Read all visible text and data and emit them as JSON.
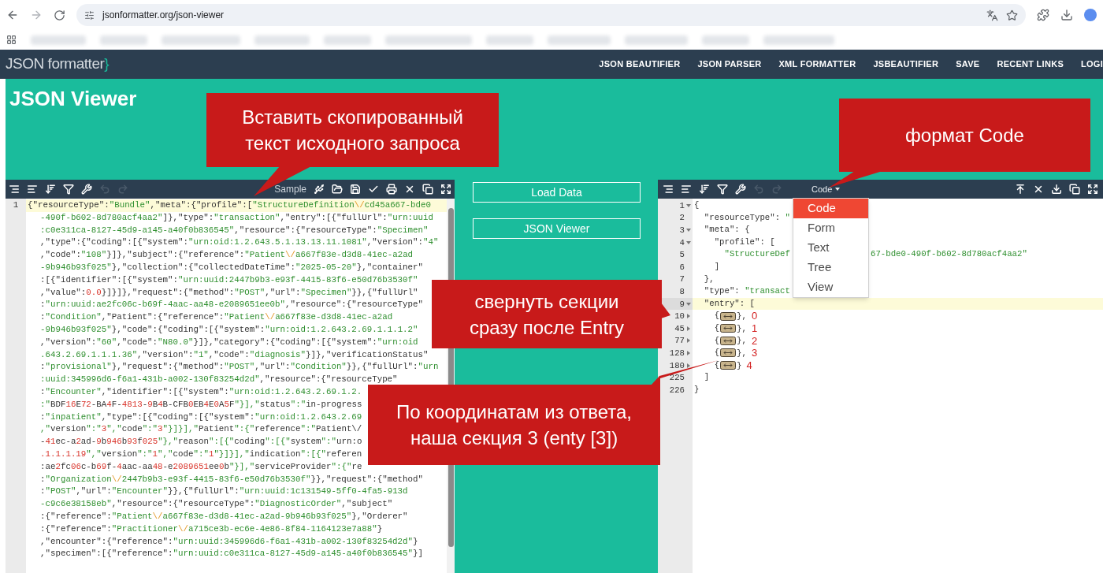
{
  "browser": {
    "url": "jsonformatter.org/json-viewer"
  },
  "site": {
    "logo": "JSON formatter",
    "logo_brace": "}",
    "nav": [
      "JSON BEAUTIFIER",
      "JSON PARSER",
      "XML FORMATTER",
      "JSBEAUTIFIER",
      "SAVE",
      "RECENT LINKS",
      "LOGI"
    ],
    "page_title": "JSON Viewer"
  },
  "input_editor": {
    "sample_label": "Sample",
    "line_number": "1",
    "lines": [
      {
        "text": "{\"resourceType\":\"Bundle\",\"meta\":{\"profile\":[\"StructureDefinition\\/cd45a667-bde0",
        "active": true
      },
      {
        "text": "-490f-b602-8d780acf4aa2\"]},\"type\":\"transaction\",\"entry\":[{\"fullUrl\":\"urn:uuid",
        "active": false
      },
      {
        "text": ":c0e311ca-8127-45d9-a145-a40f0b836545\",\"resource\":{\"resourceType\":\"Specimen\"",
        "active": false
      },
      {
        "text": ",\"type\":{\"coding\":[{\"system\":\"urn:oid:1.2.643.5.1.13.13.11.1081\",\"version\":\"4\"",
        "active": false
      },
      {
        "text": ",\"code\":\"108\"}]},\"subject\":{\"reference\":\"Patient\\/a667f83e-d3d8-41ec-a2ad",
        "active": false
      },
      {
        "text": "-9b946b93f025\"},\"collection\":{\"collectedDateTime\":\"2025-05-20\"},\"container\"",
        "active": false
      },
      {
        "text": ":[{\"identifier\":[{\"system\":\"urn:uuid:2447b9b3-e93f-4415-83f6-e50d76b3530f\"",
        "active": false
      },
      {
        "text": ",\"value\":0.0}]}]},\"request\":{\"method\":\"POST\",\"url\":\"Specimen\"}},{\"fullUrl\"",
        "active": false
      },
      {
        "text": ":\"urn:uuid:ae2fc06c-b69f-4aac-aa48-e2089651ee0b\",\"resource\":{\"resourceType\"",
        "active": false
      },
      {
        "text": ":\"Condition\",\"Patient\":{\"reference\":\"Patient\\/a667f83e-d3d8-41ec-a2ad",
        "active": false
      },
      {
        "text": "-9b946b93f025\"},\"code\":{\"coding\":[{\"system\":\"urn:oid:1.2.643.2.69.1.1.1.2\"",
        "active": false
      },
      {
        "text": ",\"version\":\"60\",\"code\":\"N80.0\"}]},\"category\":{\"coding\":[{\"system\":\"urn:oid",
        "active": false
      },
      {
        "text": ".643.2.69.1.1.1.36\",\"version\":\"1\",\"code\":\"diagnosis\"}]},\"verificationStatus\"",
        "active": false
      },
      {
        "text": ":\"provisional\"},\"request\":{\"method\":\"POST\",\"url\":\"Condition\"}},{\"fullUrl\":\"urn",
        "active": false
      },
      {
        "text": ":uuid:345996d6-f6a1-431b-a002-130f83254d2d\",\"resource\":{\"resourceType\"",
        "active": false
      },
      {
        "text": ":\"Encounter\",\"identifier\":[{\"system\":\"urn:oid:1.2.643.2.69.1.2.",
        "active": false
      },
      {
        "text": ":\"BDF16E72-BA4F-4813-9B4B-CFB0EB4E0A5F\"}],\"status\":\"in-progress",
        "active": false
      },
      {
        "text": ":\"inpatient\",\"type\":[{\"coding\":[{\"system\":\"urn:oid:1.2.643.2.69",
        "active": false
      },
      {
        "text": ",\"version\":\"3\",\"code\":\"3\"}]}],\"Patient\":{\"reference\":\"Patient\\/",
        "active": false
      },
      {
        "text": "-41ec-a2ad-9b946b93f025\"},\"reason\":[{\"coding\":[{\"system\":\"urn:o",
        "active": false
      },
      {
        "text": ".1.1.1.19\",\"version\":\"1\",\"code\":\"1\"}]}],\"indication\":[{\"referen",
        "active": false
      },
      {
        "text": ":ae2fc06c-b69f-4aac-aa48-e2089651ee0b\"}],\"serviceProvider\":{\"re",
        "active": false
      },
      {
        "text": ":\"Organization\\/2447b9b3-e93f-4415-83f6-e50d76b3530f\"}},\"request\":{\"method\"",
        "active": false
      },
      {
        "text": ":\"POST\",\"url\":\"Encounter\"}},{\"fullUrl\":\"urn:uuid:1c131549-5ff0-4fa5-913d",
        "active": false
      },
      {
        "text": "-c9c6e38158eb\",\"resource\":{\"resourceType\":\"DiagnosticOrder\",\"subject\"",
        "active": false
      },
      {
        "text": ":{\"reference\":\"Patient\\/a667f83e-d3d8-41ec-a2ad-9b946b93f025\"},\"Orderer\"",
        "active": false
      },
      {
        "text": ":{\"reference\":\"Practitioner\\/a715ce3b-ec6e-4e86-8f84-1164123e7a88\"}",
        "active": false
      },
      {
        "text": ",\"encounter\":{\"reference\":\"urn:uuid:345996d6-f6a1-431b-a002-130f83254d2d\"}",
        "active": false
      },
      {
        "text": ",\"specimen\":[{\"reference\":\"urn:uuid:c0e311ca-8127-45d9-a145-a40f0b836545\"}]",
        "active": false
      }
    ]
  },
  "middle_buttons": [
    "Load Data",
    "JSON Viewer"
  ],
  "output_editor": {
    "mode_label": "Code",
    "mode_menu": [
      {
        "label": "Code",
        "selected": true
      },
      {
        "label": "Form",
        "selected": false
      },
      {
        "label": "Text",
        "selected": false
      },
      {
        "label": "Tree",
        "selected": false
      },
      {
        "label": "View",
        "selected": false
      }
    ],
    "lines": [
      {
        "number": "1",
        "kind": "open",
        "text": "{",
        "active": false
      },
      {
        "number": "2",
        "kind": "plain",
        "text": "  \"resourceType\": \"",
        "active": false
      },
      {
        "number": "3",
        "kind": "open",
        "text": "  \"meta\": {",
        "active": false
      },
      {
        "number": "4",
        "kind": "open",
        "text": "    \"profile\": [",
        "active": false
      },
      {
        "number": "5",
        "kind": "plain",
        "text": "      \"StructureDef",
        "tail": "67-bde0-490f-b602-8d780acf4aa2\"",
        "active": false
      },
      {
        "number": "6",
        "kind": "plain",
        "text": "    ]",
        "active": false
      },
      {
        "number": "7",
        "kind": "plain",
        "text": "  },",
        "active": false
      },
      {
        "number": "8",
        "kind": "plain",
        "text": "  \"type\": \"transact",
        "active": false
      },
      {
        "number": "9",
        "kind": "open",
        "text": "  \"entry\": [",
        "active": true
      },
      {
        "number": "10",
        "kind": "collapsed",
        "text": "    {",
        "suffix": "},",
        "mark": "0",
        "active": false
      },
      {
        "number": "45",
        "kind": "collapsed",
        "text": "    {",
        "suffix": "},",
        "mark": "1",
        "active": false
      },
      {
        "number": "77",
        "kind": "collapsed",
        "text": "    {",
        "suffix": "},",
        "mark": "2",
        "active": false
      },
      {
        "number": "128",
        "kind": "collapsed",
        "text": "    {",
        "suffix": "},",
        "mark": "3",
        "active": false
      },
      {
        "number": "180",
        "kind": "collapsed",
        "text": "    {",
        "suffix": "}",
        "mark": "4",
        "active": false
      },
      {
        "number": "225",
        "kind": "plain",
        "text": "  ]",
        "active": false
      },
      {
        "number": "226",
        "kind": "plain",
        "text": "}",
        "active": false
      }
    ]
  },
  "callouts": [
    {
      "text": "Вставить скопированный текст исходного запроса"
    },
    {
      "text": "формат Code"
    },
    {
      "text": "свернуть секции сразу после Entry"
    },
    {
      "text": "По координатам из ответа, наша секция 3 (enty [3])"
    }
  ]
}
